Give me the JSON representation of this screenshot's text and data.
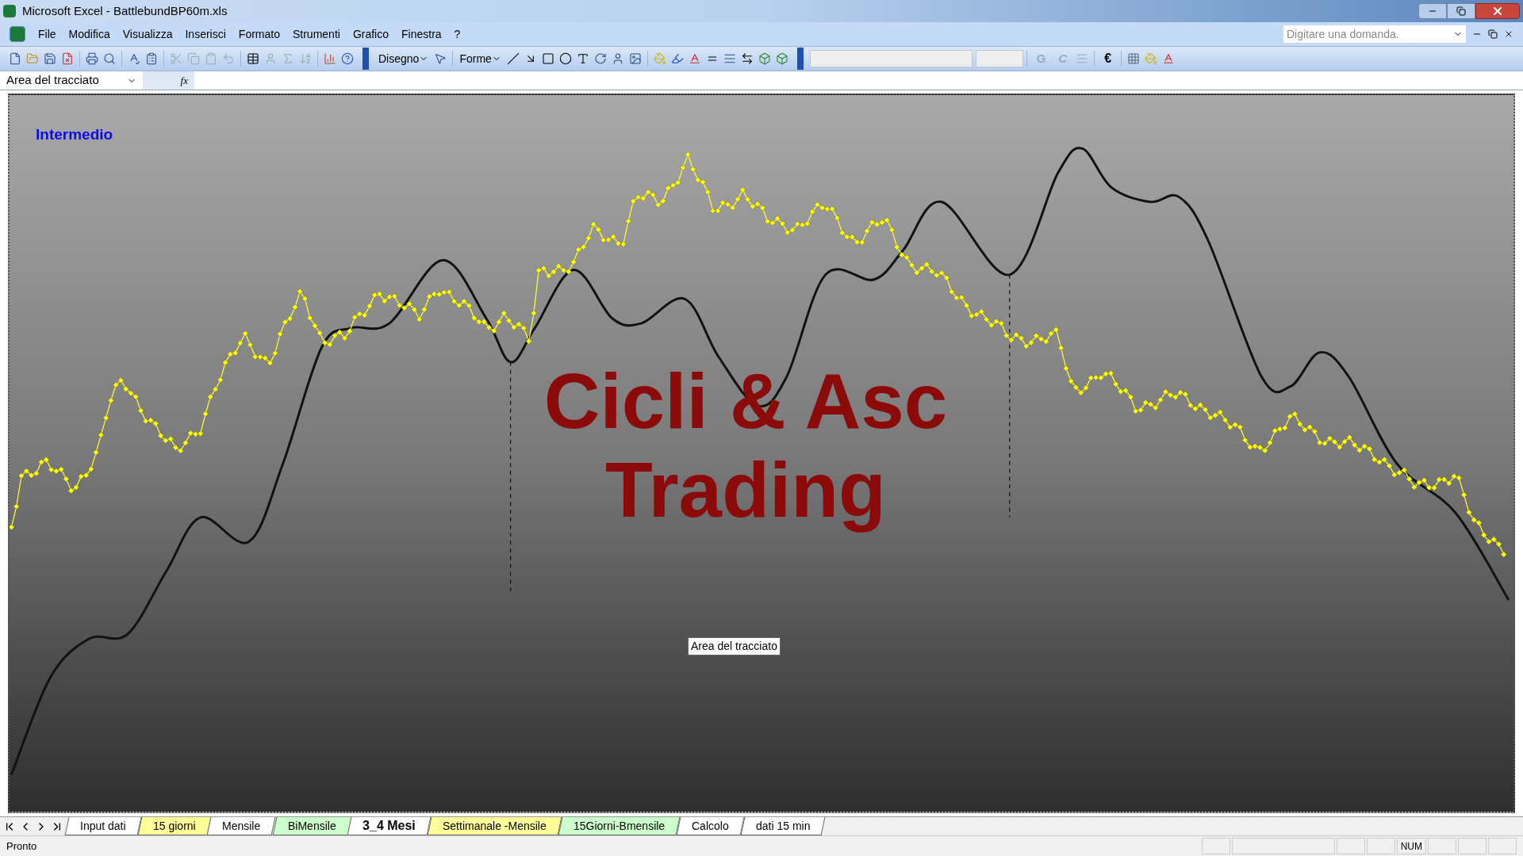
{
  "window": {
    "title": "Microsoft Excel - BattlebundBP60m.xls"
  },
  "menu": [
    {
      "label": "File"
    },
    {
      "label": "Modifica"
    },
    {
      "label": "Visualizza"
    },
    {
      "label": "Inserisci"
    },
    {
      "label": "Formato"
    },
    {
      "label": "Strumenti"
    },
    {
      "label": "Grafico"
    },
    {
      "label": "Finestra"
    },
    {
      "label": "?"
    }
  ],
  "help_box": {
    "placeholder": "Digitare una domanda."
  },
  "drawing_toolbar": {
    "draw_menu": "Disegno",
    "shapes_menu": "Forme"
  },
  "format_toolbar": {
    "bold": "G",
    "italic": "C",
    "currency": "€"
  },
  "formula_bar": {
    "name_box": "Area del tracciato",
    "function_label": "fx"
  },
  "chart": {
    "label": "Intermedio",
    "overlay_lines": [
      "Cicli & Asc",
      "Trading"
    ],
    "tooltip": "Area del tracciato"
  },
  "sheet_tabs": [
    {
      "label": "Input dati",
      "selected": false,
      "color": "#ffffff"
    },
    {
      "label": "15 giorni",
      "selected": false,
      "color": "#ffff99"
    },
    {
      "label": "Mensile",
      "selected": false,
      "color": "#ffffff"
    },
    {
      "label": "BiMensile",
      "selected": false,
      "color": "#ccffcc"
    },
    {
      "label": "3_4 Mesi",
      "selected": true,
      "color": "#ffffff"
    },
    {
      "label": "Settimanale -Mensile",
      "selected": false,
      "color": "#ffff99"
    },
    {
      "label": "15Giorni-Bmensile",
      "selected": false,
      "color": "#ccffcc"
    },
    {
      "label": "Calcolo",
      "selected": false,
      "color": "#ffffff"
    },
    {
      "label": "dati 15 min",
      "selected": false,
      "color": "#ffffff"
    }
  ],
  "status_bar": {
    "status": "Pronto",
    "indicators": [
      "NUM"
    ]
  }
}
